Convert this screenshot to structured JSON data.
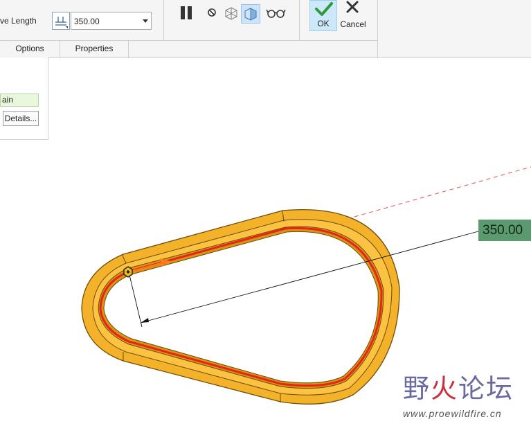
{
  "ribbon": {
    "length_label": "ve Length",
    "length_value": "350.00",
    "ok_label": "OK",
    "cancel_label": "Cancel"
  },
  "tabs": [
    {
      "label": "Options"
    },
    {
      "label": "Properties"
    }
  ],
  "panel": {
    "chain_field_text": "ain",
    "details_button": "Details..."
  },
  "viewport": {
    "dimension_value": "350.00"
  },
  "watermark": {
    "chinese_a": "野",
    "chinese_b": "火",
    "chinese_c": "论坛",
    "url": "www.proewildfire.cn"
  },
  "colors": {
    "ok_bg": "#cce8f9",
    "chain_field_bg": "#e9f7dc",
    "dimension_tag_bg": "#5a9a6e",
    "part_body": "#f3b22a",
    "selected_curve": "#e8231c",
    "direction_arrow": "#ff7a1a"
  }
}
